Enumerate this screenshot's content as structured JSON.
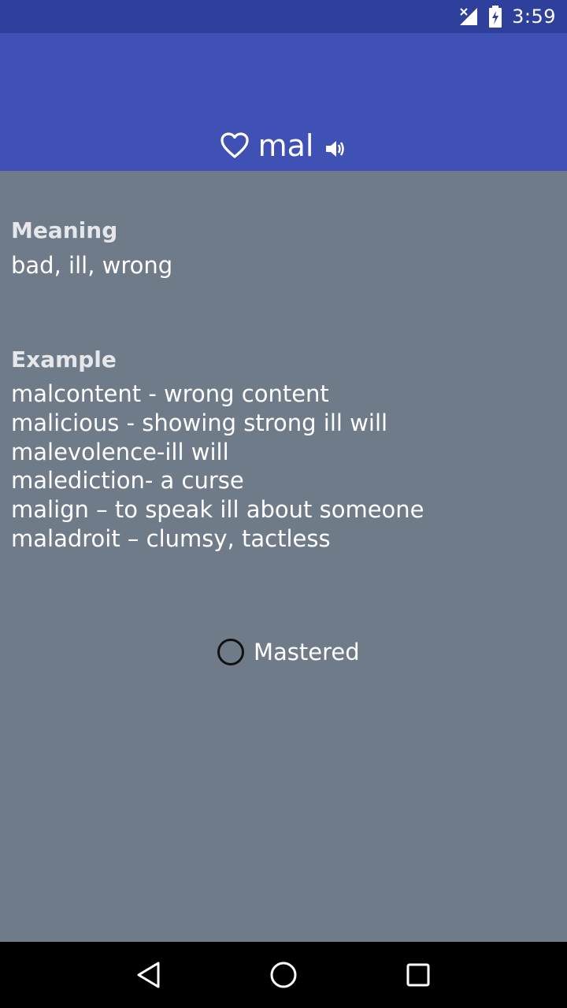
{
  "status_bar": {
    "time": "3:59",
    "icons": [
      "signal-no-data-icon",
      "battery-charging-icon"
    ]
  },
  "header": {
    "word": "mal",
    "icons": [
      "heart-outline-icon",
      "speaker-icon"
    ]
  },
  "meaning": {
    "label": "Meaning",
    "text": "bad, ill, wrong"
  },
  "example": {
    "label": "Example",
    "items": [
      "malcontent - wrong content",
      "malicious - showing strong ill will",
      "malevolence-ill will",
      "malediction- a curse",
      "malign – to speak ill about someone",
      "maladroit – clumsy, tactless"
    ]
  },
  "mastered": {
    "label": "Mastered",
    "checked": false
  },
  "nav_bar": {
    "icons": [
      "back-icon",
      "home-icon",
      "recents-icon"
    ]
  },
  "colors": {
    "status_bar": "#2f3f9c",
    "app_bar": "#3f51b5",
    "background": "#6f7b89"
  }
}
